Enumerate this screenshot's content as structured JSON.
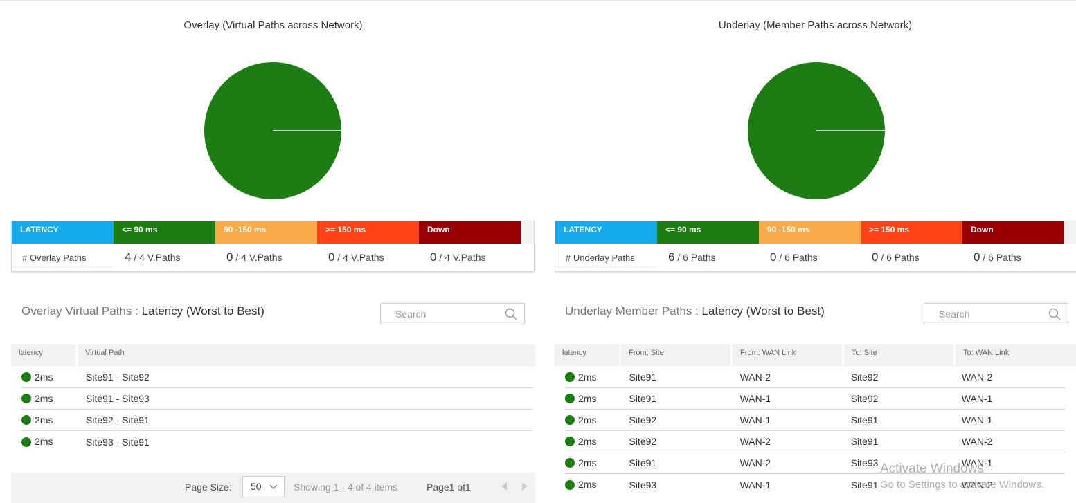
{
  "overlay": {
    "chart_title": "Overlay (Virtual Paths across Network)",
    "chart_data": {
      "type": "pie",
      "slices": [
        {
          "label": "<= 90 ms",
          "value": 4,
          "color": "#1c7d12"
        },
        {
          "label": "90 -150 ms",
          "value": 0,
          "color": "#fbac47"
        },
        {
          "label": ">= 150 ms",
          "value": 0,
          "color": "#fc4417"
        },
        {
          "label": "Down",
          "value": 0,
          "color": "#970005"
        }
      ]
    },
    "legend": {
      "header": [
        {
          "label": "LATENCY",
          "color": "#14abee"
        },
        {
          "label": "<= 90 ms",
          "color": "#1c7d12"
        },
        {
          "label": "90 -150 ms",
          "color": "#fbac47"
        },
        {
          "label": ">= 150 ms",
          "color": "#fc4417"
        },
        {
          "label": "Down",
          "color": "#970005"
        }
      ],
      "row_label": "# Overlay Paths",
      "values": [
        {
          "count": "4",
          "suffix": "/ 4 V.Paths"
        },
        {
          "count": "0",
          "suffix": "/ 4 V.Paths"
        },
        {
          "count": "0",
          "suffix": "/ 4 V.Paths"
        },
        {
          "count": "0",
          "suffix": "/ 4 V.Paths"
        }
      ]
    },
    "section_title_prefix": "Overlay Virtual Paths :",
    "section_title_main": "Latency (Worst to Best)",
    "search_placeholder": "Search",
    "columns": [
      "latency",
      "Virtual Path"
    ],
    "rows": [
      {
        "latency": "2ms",
        "path": "Site91 - Site92"
      },
      {
        "latency": "2ms",
        "path": "Site91 - Site93"
      },
      {
        "latency": "2ms",
        "path": "Site92 - Site91"
      },
      {
        "latency": "2ms",
        "path": "Site93 - Site91"
      }
    ],
    "pager": {
      "page_size_label": "Page Size:",
      "page_size": "50",
      "showing": "Showing 1 - 4 of 4 items",
      "page_of": "Page1 of1"
    }
  },
  "underlay": {
    "chart_title": "Underlay (Member Paths across Network)",
    "chart_data": {
      "type": "pie",
      "slices": [
        {
          "label": "<= 90 ms",
          "value": 6,
          "color": "#1c7d12"
        },
        {
          "label": "90 -150 ms",
          "value": 0,
          "color": "#fbac47"
        },
        {
          "label": ">= 150 ms",
          "value": 0,
          "color": "#fc4417"
        },
        {
          "label": "Down",
          "value": 0,
          "color": "#970005"
        }
      ]
    },
    "legend": {
      "header": [
        {
          "label": "LATENCY",
          "color": "#14abee"
        },
        {
          "label": "<= 90 ms",
          "color": "#1c7d12"
        },
        {
          "label": "90 -150 ms",
          "color": "#fbac47"
        },
        {
          "label": ">= 150 ms",
          "color": "#fc4417"
        },
        {
          "label": "Down",
          "color": "#970005"
        }
      ],
      "row_label": "# Underlay Paths",
      "values": [
        {
          "count": "6",
          "suffix": "/ 6 Paths"
        },
        {
          "count": "0",
          "suffix": "/ 6 Paths"
        },
        {
          "count": "0",
          "suffix": "/ 6 Paths"
        },
        {
          "count": "0",
          "suffix": "/ 6 Paths"
        }
      ]
    },
    "section_title_prefix": "Underlay Member Paths :",
    "section_title_main": "Latency (Worst to Best)",
    "search_placeholder": "Search",
    "columns": [
      "latency",
      "From: Site",
      "From: WAN Link",
      "To: Site",
      "To: WAN Link"
    ],
    "rows": [
      {
        "latency": "2ms",
        "from_site": "Site91",
        "from_wan": "WAN-2",
        "to_site": "Site92",
        "to_wan": "WAN-2"
      },
      {
        "latency": "2ms",
        "from_site": "Site91",
        "from_wan": "WAN-1",
        "to_site": "Site92",
        "to_wan": "WAN-1"
      },
      {
        "latency": "2ms",
        "from_site": "Site92",
        "from_wan": "WAN-1",
        "to_site": "Site91",
        "to_wan": "WAN-1"
      },
      {
        "latency": "2ms",
        "from_site": "Site92",
        "from_wan": "WAN-2",
        "to_site": "Site91",
        "to_wan": "WAN-2"
      },
      {
        "latency": "2ms",
        "from_site": "Site91",
        "from_wan": "WAN-2",
        "to_site": "Site93",
        "to_wan": "WAN-1"
      },
      {
        "latency": "2ms",
        "from_site": "Site93",
        "from_wan": "WAN-1",
        "to_site": "Site91",
        "to_wan": "WAN-2"
      }
    ]
  },
  "watermark": {
    "line1": "Activate Windows",
    "line2": "Go to Settings to activate Windows."
  },
  "colors": {
    "ok_green": "#1c7d12",
    "latency_blue": "#14abee",
    "warn_orange": "#fbac47",
    "high_red": "#fc4417",
    "down_darkred": "#970005"
  }
}
